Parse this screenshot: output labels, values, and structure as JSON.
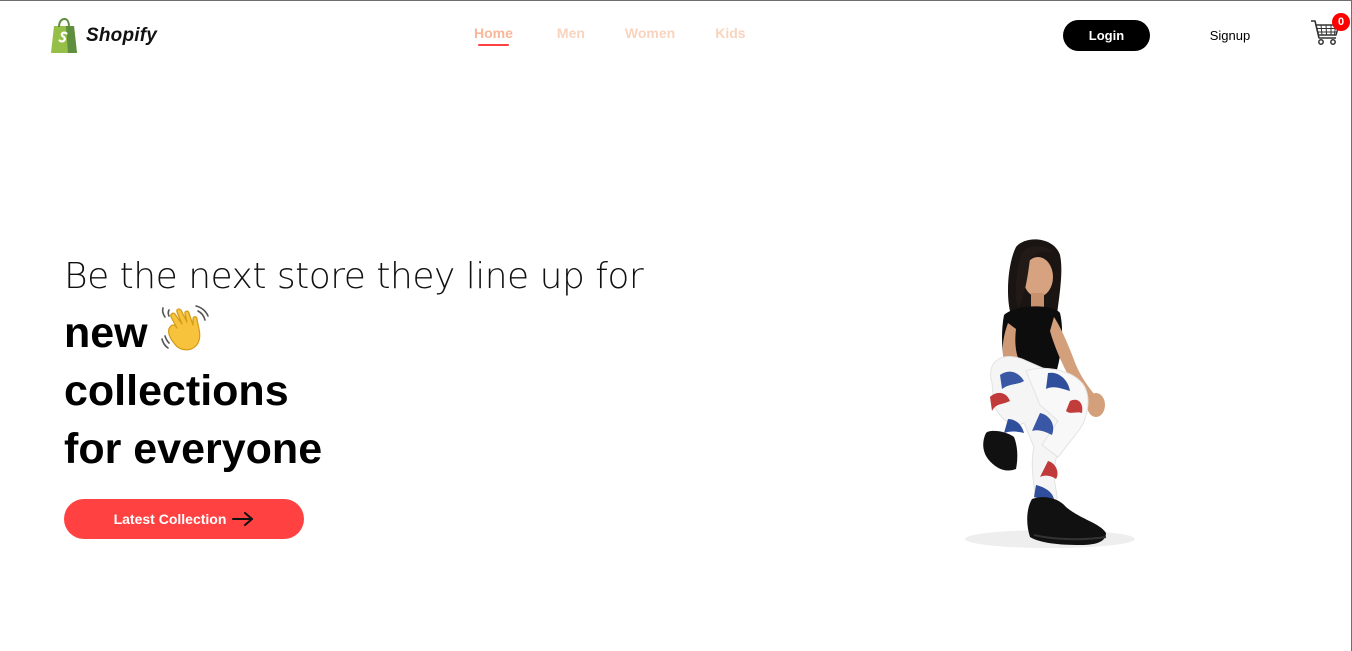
{
  "brand": {
    "name": "Shopify",
    "logo_icon": "shopping-bag-icon"
  },
  "nav": {
    "items": [
      {
        "label": "Home",
        "active": true
      },
      {
        "label": "Men",
        "active": false
      },
      {
        "label": "Women",
        "active": false
      },
      {
        "label": "Kids",
        "active": false
      }
    ]
  },
  "auth": {
    "login_label": "Login",
    "signup_label": "Signup"
  },
  "cart": {
    "icon": "cart-icon",
    "count": "0"
  },
  "hero": {
    "tagline": "Be the next store they line up for",
    "line1": "new",
    "line2": "collections",
    "line3": "for everyone",
    "wave_icon": "waving-hand-icon",
    "cta_label": "Latest Collection",
    "cta_icon": "arrow-right-icon",
    "image": "hero-model-image"
  },
  "colors": {
    "accent": "#ff4141",
    "nav_inactive": "#f8d3bd",
    "nav_active": "#f9b79a",
    "badge": "#ff0000",
    "brand_green": "#95bf47"
  }
}
